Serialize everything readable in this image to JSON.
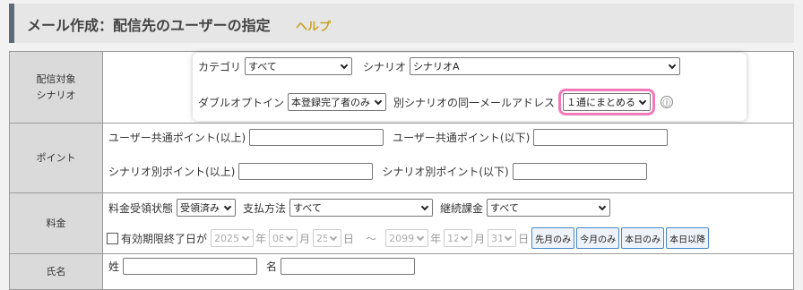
{
  "header": {
    "title": "メール作成：配信先のユーザーの指定",
    "help": "ヘルプ"
  },
  "scenario_row": {
    "label_line1": "配信対象",
    "label_line2": "シナリオ",
    "category_label": "カテゴリ",
    "category_value": "すべて",
    "scenario_label": "シナリオ",
    "scenario_value": "シナリオA",
    "double_optin_label": "ダブルオプトイン",
    "double_optin_value": "本登録完了者のみ",
    "same_email_label": "別シナリオの同一メールアドレス",
    "same_email_value": "１通にまとめる",
    "info_icon": "ⓘ"
  },
  "point_row": {
    "label": "ポイント",
    "common_min_label": "ユーザー共通ポイント(以上)",
    "common_max_label": "ユーザー共通ポイント(以下)",
    "scenario_min_label": "シナリオ別ポイント(以上)",
    "scenario_max_label": "シナリオ別ポイント(以下)"
  },
  "fee_row": {
    "label": "料金",
    "status_label": "料金受領状態",
    "status_value": "受領済み",
    "payment_label": "支払方法",
    "payment_value": "すべて",
    "recurring_label": "継続課金",
    "recurring_value": "すべて",
    "expiry_label": "有効期限終了日が",
    "from_year": "2025",
    "from_month": "08",
    "from_day": "25",
    "to_year": "2099",
    "to_month": "12",
    "to_day": "31",
    "unit_year": "年",
    "unit_month": "月",
    "unit_day": "日",
    "tilde": "～",
    "btn_first_of_month": "先月のみ",
    "btn_this_month": "今月のみ",
    "btn_today": "本日のみ",
    "btn_after_today": "本日以降"
  },
  "name_row": {
    "label": "氏名",
    "last_label": "姓",
    "first_label": "名"
  }
}
